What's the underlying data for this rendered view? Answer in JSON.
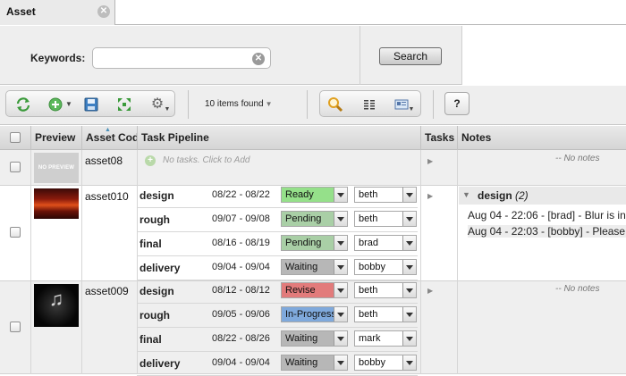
{
  "tab": {
    "label": "Asset",
    "close_glyph": "✕"
  },
  "search": {
    "keywords_label": "Keywords:",
    "keywords_value": "",
    "button_label": "Search"
  },
  "toolbar": {
    "items_found": "10 items found",
    "help_label": "?",
    "icons": [
      "refresh-icon",
      "add-icon",
      "save-icon",
      "expand-icon",
      "gear-icon",
      "search-icon",
      "columns-icon",
      "card-view-icon"
    ]
  },
  "table": {
    "headers": [
      "Preview",
      "Asset Cod",
      "Task Pipeline",
      "Tasks",
      "Notes"
    ],
    "rows": [
      {
        "asset_code": "asset08",
        "preview_text": "NO PREVIEW",
        "no_tasks_text": "No tasks. Click to Add",
        "no_notes_text": "-- No notes",
        "tasks": []
      },
      {
        "asset_code": "asset010",
        "tasks": [
          {
            "name": "design",
            "dates": "08/22 - 08/22",
            "status": "Ready",
            "status_color": "#95e08a",
            "assignee": "beth"
          },
          {
            "name": "rough",
            "dates": "09/07 - 09/08",
            "status": "Pending",
            "status_color": "#a9cfa6",
            "assignee": "beth"
          },
          {
            "name": "final",
            "dates": "08/16 - 08/19",
            "status": "Pending",
            "status_color": "#a9cfa6",
            "assignee": "brad"
          },
          {
            "name": "delivery",
            "dates": "09/04 - 09/04",
            "status": "Waiting",
            "status_color": "#b7b7b7",
            "assignee": "bobby"
          }
        ],
        "notes": {
          "group_title": "design",
          "group_count": "(2)",
          "entries": [
            "Aug 04 - 22:06 - [brad] - Blur is in",
            "Aug 04 - 22:03 - [bobby] - Please"
          ]
        }
      },
      {
        "asset_code": "asset009",
        "no_notes_text": "-- No notes",
        "tasks": [
          {
            "name": "design",
            "dates": "08/12 - 08/12",
            "status": "Revise",
            "status_color": "#e27b7b",
            "assignee": "beth"
          },
          {
            "name": "rough",
            "dates": "09/05 - 09/06",
            "status": "In-Progress",
            "status_color": "#7fa9dc",
            "assignee": "beth"
          },
          {
            "name": "final",
            "dates": "08/22 - 08/26",
            "status": "Waiting",
            "status_color": "#b7b7b7",
            "assignee": "mark"
          },
          {
            "name": "delivery",
            "dates": "09/04 - 09/04",
            "status": "Waiting",
            "status_color": "#b7b7b7",
            "assignee": "bobby"
          }
        ]
      }
    ]
  }
}
